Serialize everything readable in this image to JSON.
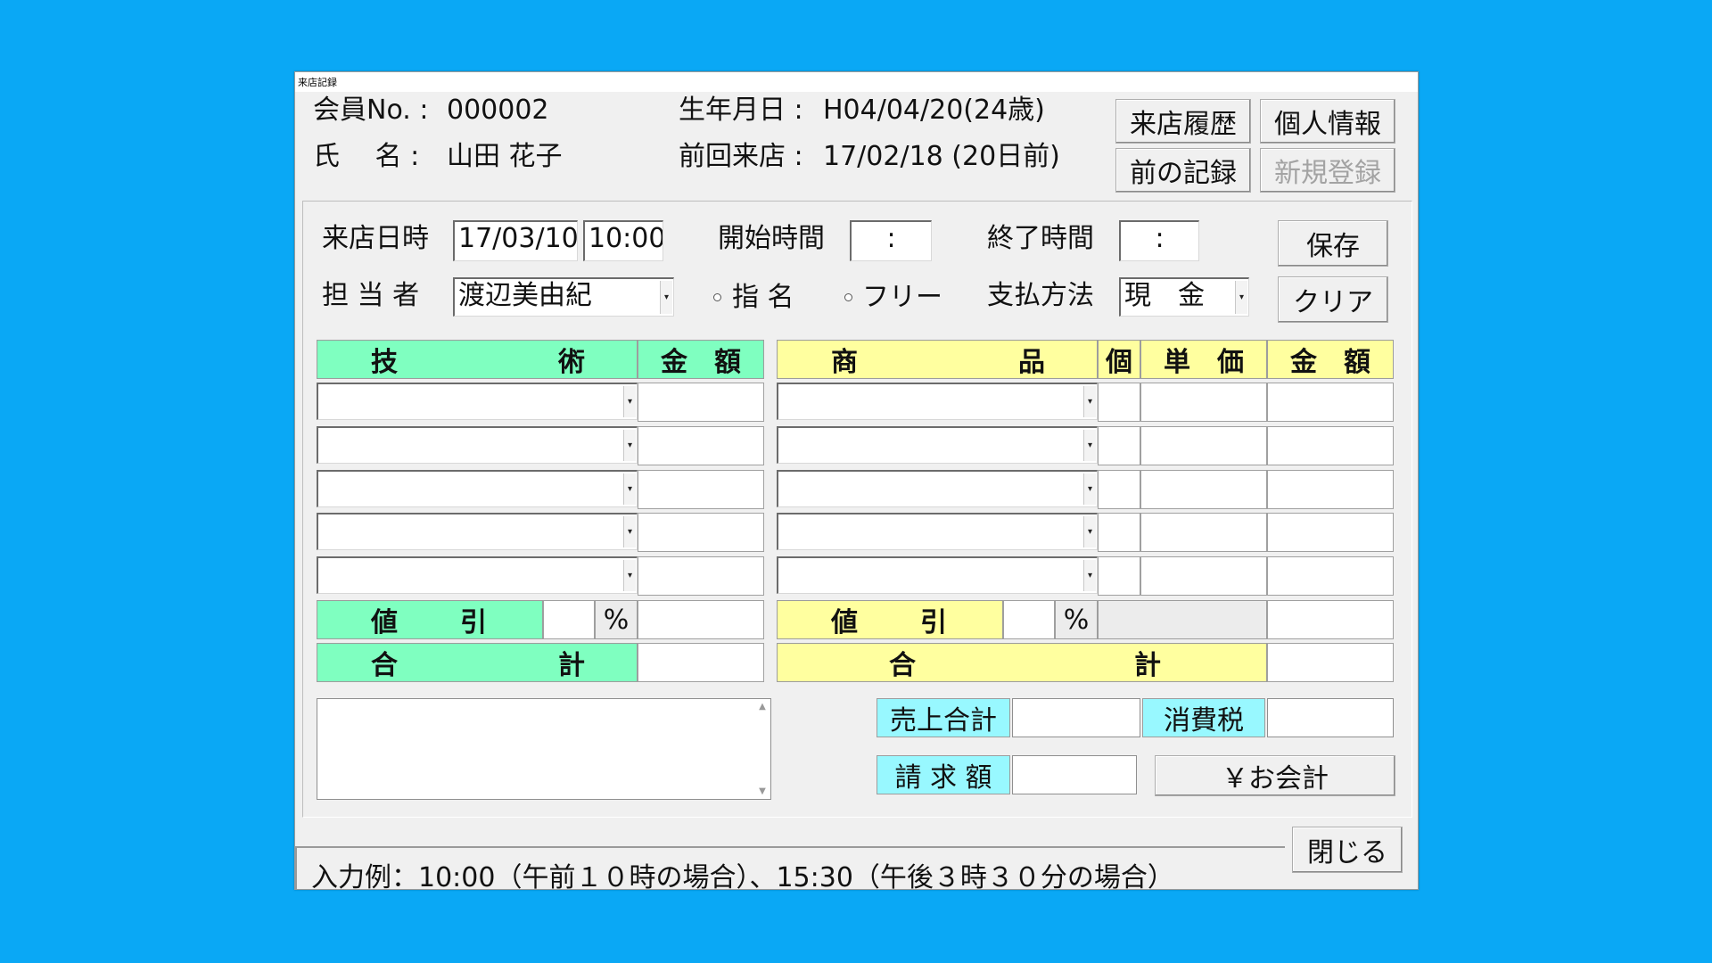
{
  "window": {
    "title": "来店記録"
  },
  "header": {
    "member_no_label": "会員No. :",
    "member_no": "000002",
    "name_label": "氏　 名 :",
    "name": "山田 花子",
    "birth_label": "生年月日 :",
    "birth": "H04/04/20(24歳)",
    "last_visit_label": "前回来店 :",
    "last_visit": "17/02/18 (20日前)"
  },
  "buttons": {
    "history": "来店履歴",
    "personal": "個人情報",
    "prev_record": "前の記録",
    "new_register": "新規登録",
    "save": "保存",
    "clear": "クリア",
    "checkout": "￥お会計",
    "close": "閉じる"
  },
  "visit": {
    "datetime_label": "来店日時",
    "date": "17/03/10",
    "time": "10:00",
    "start_label": "開始時間",
    "start_value": ":",
    "end_label": "終了時間",
    "end_value": ":",
    "staff_label": "担 当 者",
    "staff": "渡辺美由紀",
    "radio_designated": "指 名",
    "radio_free": "フリー",
    "payment_label": "支払方法",
    "payment": "現　金"
  },
  "tech_table": {
    "col_tech_a": "技",
    "col_tech_b": "術",
    "col_amount": "金　額",
    "discount_a": "値",
    "discount_b": "引",
    "percent": "%",
    "total_a": "合",
    "total_b": "計"
  },
  "product_table": {
    "col_product_a": "商",
    "col_product_b": "品",
    "col_qty": "個",
    "col_unit_price": "単　価",
    "col_amount": "金　額",
    "discount_a": "値",
    "discount_b": "引",
    "percent": "%",
    "total_a": "合",
    "total_b": "計"
  },
  "summary": {
    "sales_total_label": "売上合計",
    "tax_label": "消費税",
    "billing_label": "請 求 額"
  },
  "status_text": "入力例：10:00（午前１０時の場合）、15:30（午後３時３０分の場合）",
  "icons": {
    "combo": "dropdown-arrow-icon"
  }
}
